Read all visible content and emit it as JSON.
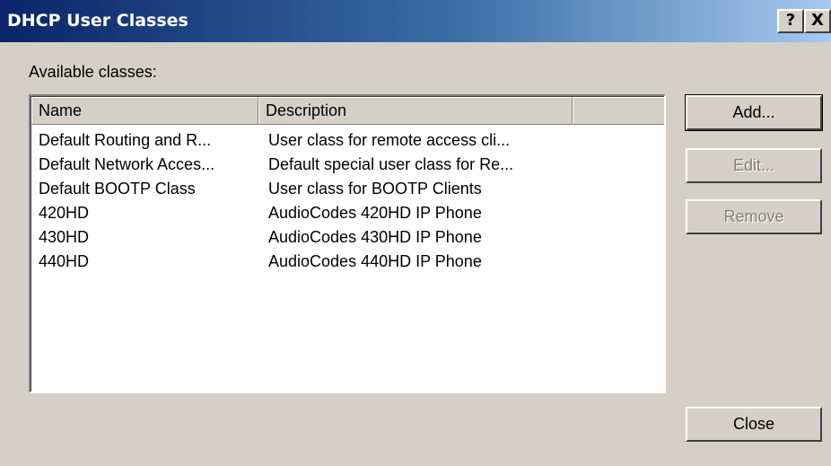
{
  "window": {
    "title": "DHCP User Classes",
    "help_glyph": "?",
    "close_glyph": "X"
  },
  "label": "Available classes:",
  "columns": [
    "Name",
    "Description",
    ""
  ],
  "rows": [
    {
      "name": "Default Routing and R...",
      "description": "User class for remote access cli..."
    },
    {
      "name": "Default Network Acces...",
      "description": "Default special user class for Re..."
    },
    {
      "name": "Default BOOTP Class",
      "description": "User class for BOOTP Clients"
    },
    {
      "name": "420HD",
      "description": "AudioCodes 420HD IP Phone"
    },
    {
      "name": "430HD",
      "description": "AudioCodes 430HD IP Phone"
    },
    {
      "name": "440HD",
      "description": "AudioCodes 440HD IP Phone"
    }
  ],
  "buttons": {
    "add": "Add...",
    "edit": "Edit...",
    "remove": "Remove",
    "close": "Close"
  }
}
